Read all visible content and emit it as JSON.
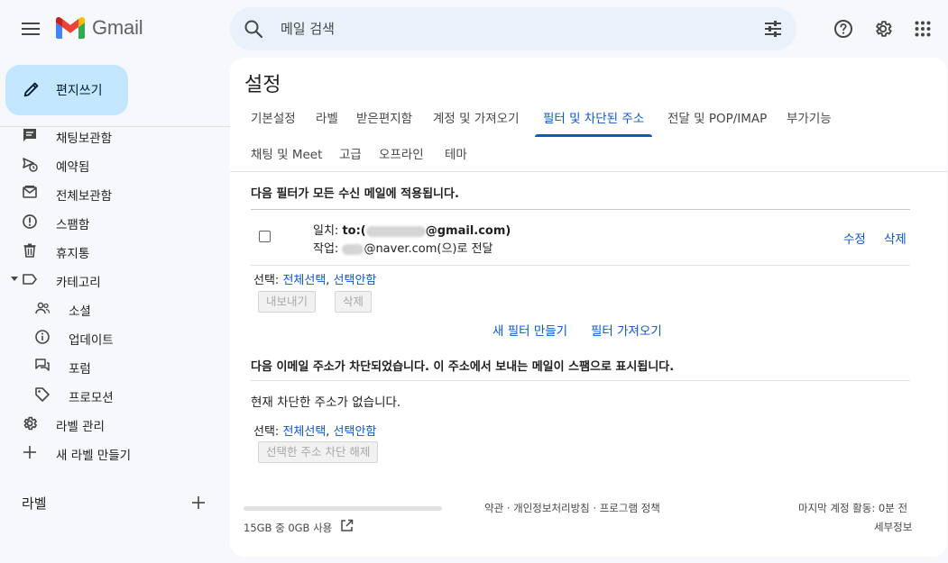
{
  "header": {
    "app_name": "Gmail",
    "search_placeholder": "메일 검색",
    "icons": [
      "menu-icon",
      "search-icon",
      "tune-icon",
      "help-icon",
      "gear-icon",
      "apps-icon"
    ],
    "logo_colors": [
      "#ea4335",
      "#fbbc04",
      "#34a853",
      "#4285f4",
      "#c5221f"
    ]
  },
  "sidebar": {
    "compose_label": "편지쓰기",
    "items": [
      {
        "label": "채팅보관함",
        "icon": "chat-archive-icon"
      },
      {
        "label": "예약됨",
        "icon": "scheduled-icon"
      },
      {
        "label": "전체보관함",
        "icon": "all-mail-icon"
      },
      {
        "label": "스팸함",
        "icon": "spam-icon"
      },
      {
        "label": "휴지통",
        "icon": "trash-icon"
      },
      {
        "label": "카테고리",
        "icon": "label-icon"
      },
      {
        "label": "소셜",
        "icon": "social-icon"
      },
      {
        "label": "업데이트",
        "icon": "info-icon"
      },
      {
        "label": "포럼",
        "icon": "forum-icon"
      },
      {
        "label": "프로모션",
        "icon": "tag-icon"
      },
      {
        "label": "라벨 관리",
        "icon": "gear-icon"
      },
      {
        "label": "새 라벨 만들기",
        "icon": "plus-icon"
      }
    ],
    "labels_heading": "라벨"
  },
  "main": {
    "title": "설정",
    "tabs": [
      {
        "label": "기본설정"
      },
      {
        "label": "라벨"
      },
      {
        "label": "받은편지함"
      },
      {
        "label": "계정 및 가져오기"
      },
      {
        "label": "필터 및 차단된 주소",
        "active": true
      },
      {
        "label": "전달 및 POP/IMAP"
      },
      {
        "label": "부가기능"
      },
      {
        "label": "채팅 및 Meet"
      },
      {
        "label": "고급"
      },
      {
        "label": "오프라인"
      },
      {
        "label": "테마"
      }
    ],
    "filters": {
      "heading": "다음 필터가 모든 수신 메일에 적용됩니다.",
      "rows": [
        {
          "match_label": "일치: ",
          "match_prefix": "to:(",
          "match_suffix": "@gmail.com)",
          "action_label": "작업: ",
          "action_suffix": "@naver.com(으)로 전달",
          "edit": "수정",
          "delete": "삭제"
        }
      ],
      "select_label": "선택: ",
      "select_all": "전체선택",
      "select_sep": ", ",
      "select_none": "선택안함",
      "export_button": "내보내기",
      "delete_button": "삭제",
      "create_filter": "새 필터 만들기",
      "import_filter": "필터 가져오기"
    },
    "blocked": {
      "heading": "다음 이메일 주소가 차단되었습니다. 이 주소에서 보내는 메일이 스팸으로 표시됩니다.",
      "empty_text": "현재 차단한 주소가 없습니다.",
      "select_label": "선택: ",
      "select_all": "전체선택",
      "select_sep": ", ",
      "select_none": "선택안함",
      "unblock_button": "선택한 주소 차단 해제"
    },
    "footer": {
      "storage_text": "15GB 중 0GB 사용",
      "storage_fraction": 0.0,
      "links": "약관 · 개인정보처리방침 · 프로그램 정책",
      "last_activity": "마지막 계정 활동: 0분 전",
      "details": "세부정보"
    }
  }
}
